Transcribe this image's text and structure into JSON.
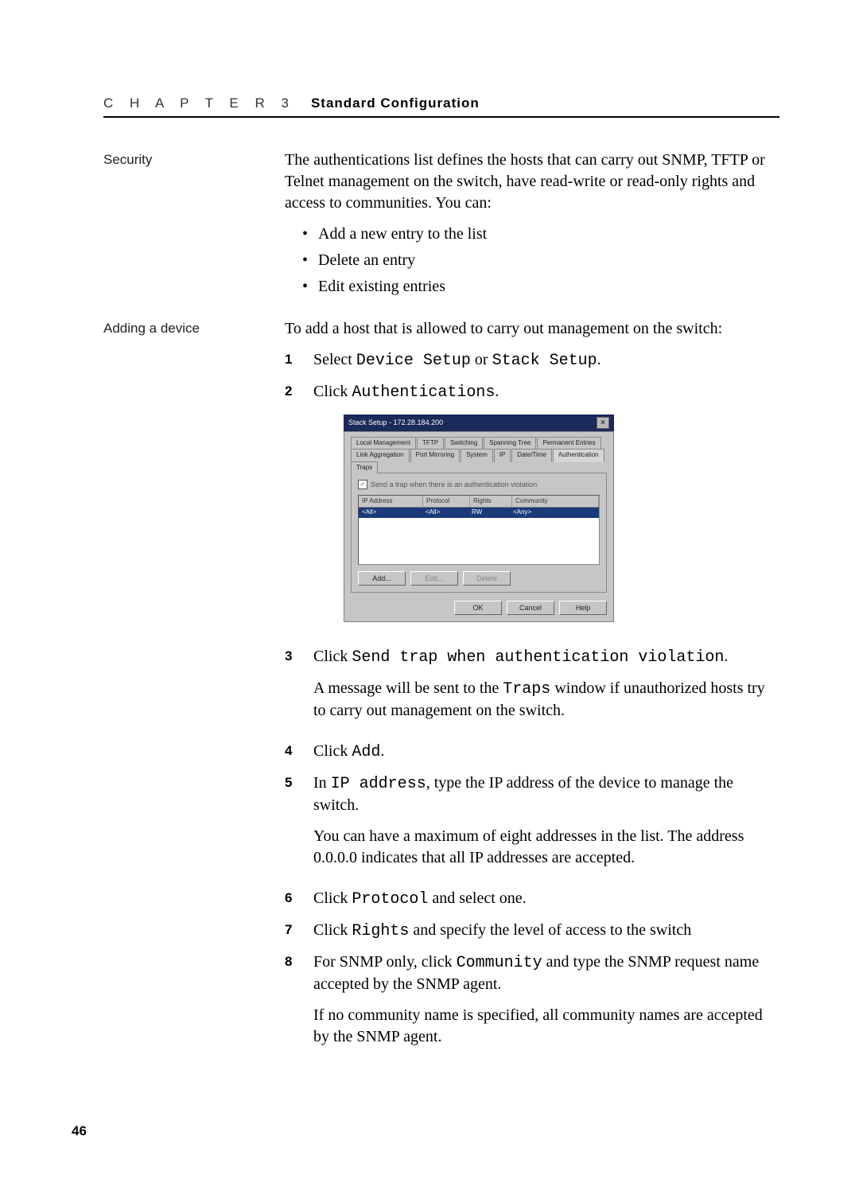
{
  "header": {
    "chapter": "C H A P T E R  3",
    "title": "Standard Configuration"
  },
  "security": {
    "label": "Security",
    "intro": "The authentications list defines the hosts that can carry out SNMP, TFTP or Telnet management on the switch, have read-write or read-only rights and access to communities. You can:",
    "bullets": [
      "Add a new entry to the list",
      "Delete an entry",
      "Edit existing entries"
    ]
  },
  "adding": {
    "label": "Adding a device",
    "intro": "To add a host that is allowed to carry out management on the switch:",
    "s1_a": "Select ",
    "s1_c1": "Device Setup",
    "s1_b": " or ",
    "s1_c2": "Stack Setup",
    "s1_d": ".",
    "s2_a": "Click ",
    "s2_c": "Authentications",
    "s2_b": ".",
    "s3_a": "Click ",
    "s3_c": "Send trap when authentication violation",
    "s3_b": ".",
    "s3_p2a": "A message will be sent to the ",
    "s3_p2c": "Traps",
    "s3_p2b": " window if unauthorized hosts try to carry out management on the switch.",
    "s4_a": "Click ",
    "s4_c": "Add",
    "s4_b": ".",
    "s5_a": "In ",
    "s5_c": "IP address",
    "s5_b": ", type the IP address of the device to manage the switch.",
    "s5_p2": "You can have a maximum of eight addresses in the list. The address 0.0.0.0 indicates that all IP addresses are accepted.",
    "s6_a": "Click ",
    "s6_c": "Protocol",
    "s6_b": " and select one.",
    "s7_a": "Click ",
    "s7_c": "Rights",
    "s7_b": " and specify the level of access to the switch",
    "s8_a": "For SNMP only, click ",
    "s8_c": "Community",
    "s8_b": " and type the SNMP request name accepted by the SNMP agent.",
    "s8_p2": "If no community name is specified, all community names are accepted by the SNMP agent."
  },
  "dialog": {
    "title": "Stack Setup - 172.28.184.200",
    "tabs": [
      "Local Management",
      "TFTP",
      "Switching",
      "Spanning Tree",
      "Permanent Entries",
      "Link Aggregation",
      "Port Mirroring",
      "System",
      "IP",
      "Date/Time",
      "Authentication",
      "Traps"
    ],
    "checkbox": "Send a trap when there is an authentication violation",
    "cols": [
      "IP Address",
      "Protocol",
      "Rights",
      "Community"
    ],
    "row": [
      "<All>",
      "<All>",
      "RW",
      "<Any>"
    ],
    "btns": {
      "add": "Add...",
      "edit": "Edit...",
      "del": "Delete",
      "ok": "OK",
      "cancel": "Cancel",
      "help": "Help"
    }
  },
  "page_number": "46"
}
